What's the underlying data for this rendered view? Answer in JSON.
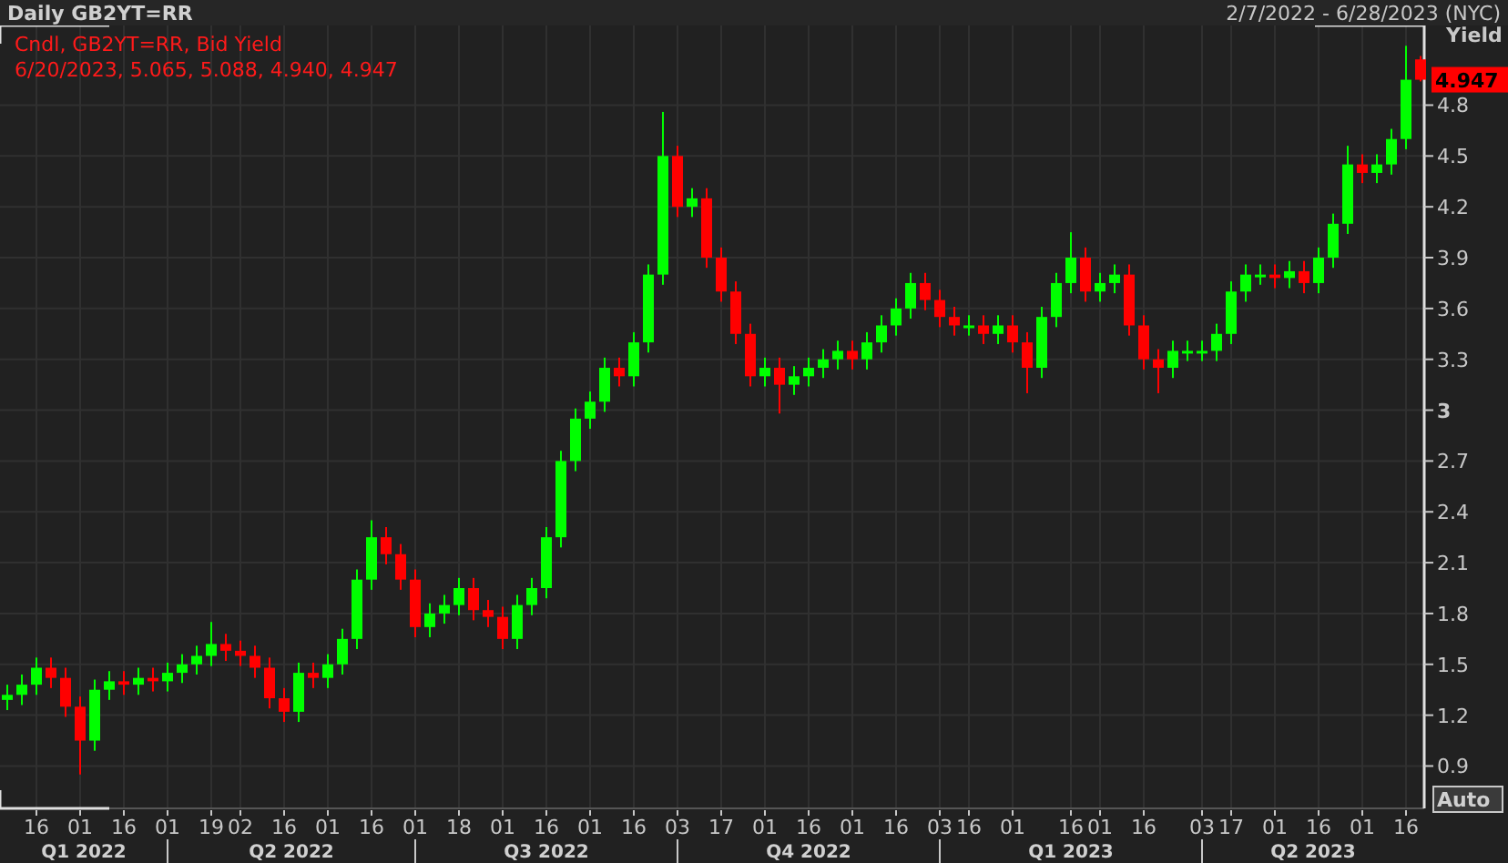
{
  "header": {
    "title": "Daily GB2YT=RR",
    "range": "2/7/2022 - 6/28/2023 (NYC)"
  },
  "legend": [
    "Cndl, GB2YT=RR, Bid Yield",
    "6/20/2023, 5.065, 5.088, 4.940, 4.947"
  ],
  "chart": {
    "last_value": "4.947",
    "auto_button": "Auto",
    "quarters": [
      "Q1 2022",
      "Q2 2022",
      "Q3 2022",
      "Q4 2022",
      "Q1 2023",
      "Q2 2023"
    ],
    "chart_data": {
      "type": "candlestick",
      "ylabel": "Yield",
      "grid": true,
      "ohlc": [
        [
          1.29,
          1.38,
          1.23,
          1.32
        ],
        [
          1.32,
          1.44,
          1.26,
          1.38
        ],
        [
          1.38,
          1.54,
          1.32,
          1.48
        ],
        [
          1.48,
          1.54,
          1.36,
          1.42
        ],
        [
          1.42,
          1.48,
          1.19,
          1.25
        ],
        [
          1.25,
          1.31,
          0.85,
          1.05
        ],
        [
          1.05,
          1.41,
          0.99,
          1.35
        ],
        [
          1.35,
          1.46,
          1.29,
          1.4
        ],
        [
          1.4,
          1.46,
          1.32,
          1.38
        ],
        [
          1.38,
          1.48,
          1.32,
          1.42
        ],
        [
          1.42,
          1.48,
          1.34,
          1.4
        ],
        [
          1.4,
          1.51,
          1.34,
          1.45
        ],
        [
          1.45,
          1.56,
          1.39,
          1.5
        ],
        [
          1.5,
          1.61,
          1.44,
          1.55
        ],
        [
          1.55,
          1.75,
          1.49,
          1.62
        ],
        [
          1.62,
          1.68,
          1.52,
          1.58
        ],
        [
          1.58,
          1.64,
          1.49,
          1.55
        ],
        [
          1.55,
          1.61,
          1.42,
          1.48
        ],
        [
          1.48,
          1.54,
          1.24,
          1.3
        ],
        [
          1.3,
          1.36,
          1.16,
          1.22
        ],
        [
          1.22,
          1.51,
          1.16,
          1.45
        ],
        [
          1.45,
          1.51,
          1.36,
          1.42
        ],
        [
          1.42,
          1.56,
          1.36,
          1.5
        ],
        [
          1.5,
          1.71,
          1.44,
          1.65
        ],
        [
          1.65,
          2.06,
          1.59,
          2.0
        ],
        [
          2.0,
          2.35,
          1.94,
          2.25
        ],
        [
          2.25,
          2.31,
          2.09,
          2.15
        ],
        [
          2.15,
          2.21,
          1.94,
          2.0
        ],
        [
          2.0,
          2.06,
          1.66,
          1.72
        ],
        [
          1.72,
          1.86,
          1.66,
          1.8
        ],
        [
          1.8,
          1.91,
          1.74,
          1.85
        ],
        [
          1.85,
          2.01,
          1.79,
          1.95
        ],
        [
          1.95,
          2.01,
          1.76,
          1.82
        ],
        [
          1.82,
          1.88,
          1.72,
          1.78
        ],
        [
          1.78,
          1.84,
          1.59,
          1.65
        ],
        [
          1.65,
          1.91,
          1.59,
          1.85
        ],
        [
          1.85,
          2.01,
          1.79,
          1.95
        ],
        [
          1.95,
          2.31,
          1.89,
          2.25
        ],
        [
          2.25,
          2.76,
          2.19,
          2.7
        ],
        [
          2.7,
          3.01,
          2.64,
          2.95
        ],
        [
          2.95,
          3.11,
          2.89,
          3.05
        ],
        [
          3.05,
          3.31,
          2.99,
          3.25
        ],
        [
          3.25,
          3.31,
          3.14,
          3.2
        ],
        [
          3.2,
          3.46,
          3.14,
          3.4
        ],
        [
          3.4,
          3.86,
          3.34,
          3.8
        ],
        [
          3.8,
          4.76,
          3.74,
          4.5
        ],
        [
          4.5,
          4.56,
          4.14,
          4.2
        ],
        [
          4.2,
          4.31,
          4.14,
          4.25
        ],
        [
          4.25,
          4.31,
          3.84,
          3.9
        ],
        [
          3.9,
          3.96,
          3.64,
          3.7
        ],
        [
          3.7,
          3.76,
          3.39,
          3.45
        ],
        [
          3.45,
          3.51,
          3.14,
          3.2
        ],
        [
          3.2,
          3.31,
          3.14,
          3.25
        ],
        [
          3.25,
          3.31,
          2.98,
          3.15
        ],
        [
          3.15,
          3.26,
          3.09,
          3.2
        ],
        [
          3.2,
          3.31,
          3.14,
          3.25
        ],
        [
          3.25,
          3.36,
          3.19,
          3.3
        ],
        [
          3.3,
          3.41,
          3.24,
          3.35
        ],
        [
          3.35,
          3.41,
          3.24,
          3.3
        ],
        [
          3.3,
          3.46,
          3.24,
          3.4
        ],
        [
          3.4,
          3.56,
          3.34,
          3.5
        ],
        [
          3.5,
          3.66,
          3.44,
          3.6
        ],
        [
          3.6,
          3.81,
          3.54,
          3.75
        ],
        [
          3.75,
          3.81,
          3.59,
          3.65
        ],
        [
          3.65,
          3.71,
          3.49,
          3.55
        ],
        [
          3.55,
          3.61,
          3.44,
          3.5
        ],
        [
          3.5,
          3.56,
          3.44,
          3.5
        ],
        [
          3.5,
          3.56,
          3.39,
          3.45
        ],
        [
          3.45,
          3.56,
          3.39,
          3.5
        ],
        [
          3.5,
          3.56,
          3.34,
          3.4
        ],
        [
          3.4,
          3.46,
          3.1,
          3.25
        ],
        [
          3.25,
          3.61,
          3.19,
          3.55
        ],
        [
          3.55,
          3.81,
          3.49,
          3.75
        ],
        [
          3.75,
          4.05,
          3.69,
          3.9
        ],
        [
          3.9,
          3.96,
          3.64,
          3.7
        ],
        [
          3.7,
          3.81,
          3.64,
          3.75
        ],
        [
          3.75,
          3.86,
          3.69,
          3.8
        ],
        [
          3.8,
          3.86,
          3.44,
          3.5
        ],
        [
          3.5,
          3.56,
          3.24,
          3.3
        ],
        [
          3.3,
          3.36,
          3.1,
          3.25
        ],
        [
          3.25,
          3.41,
          3.19,
          3.35
        ],
        [
          3.35,
          3.41,
          3.29,
          3.35
        ],
        [
          3.35,
          3.41,
          3.29,
          3.35
        ],
        [
          3.35,
          3.51,
          3.29,
          3.45
        ],
        [
          3.45,
          3.76,
          3.39,
          3.7
        ],
        [
          3.7,
          3.86,
          3.64,
          3.8
        ],
        [
          3.8,
          3.86,
          3.74,
          3.8
        ],
        [
          3.8,
          3.86,
          3.72,
          3.78
        ],
        [
          3.78,
          3.88,
          3.72,
          3.82
        ],
        [
          3.82,
          3.88,
          3.69,
          3.75
        ],
        [
          3.75,
          3.96,
          3.69,
          3.9
        ],
        [
          3.9,
          4.16,
          3.84,
          4.1
        ],
        [
          4.1,
          4.56,
          4.04,
          4.45
        ],
        [
          4.45,
          4.51,
          4.34,
          4.4
        ],
        [
          4.4,
          4.51,
          4.34,
          4.45
        ],
        [
          4.45,
          4.66,
          4.39,
          4.6
        ],
        [
          4.6,
          5.15,
          4.54,
          4.95
        ],
        [
          5.07,
          5.09,
          4.94,
          4.95
        ]
      ],
      "ylim": [
        0.65,
        5.27
      ],
      "yticks": [
        0.9,
        1.2,
        1.5,
        1.8,
        2.1,
        2.4,
        2.7,
        3,
        3.3,
        3.6,
        3.9,
        4.2,
        4.5,
        4.8
      ],
      "categories": [
        null,
        null,
        "16",
        null,
        null,
        "01",
        null,
        null,
        "16",
        null,
        null,
        "01",
        null,
        null,
        "19",
        null,
        "02",
        null,
        null,
        "16",
        null,
        null,
        "01",
        null,
        null,
        "16",
        null,
        null,
        "01",
        null,
        null,
        "18",
        null,
        null,
        "01",
        null,
        null,
        "16",
        null,
        null,
        "01",
        null,
        null,
        "16",
        null,
        null,
        "03",
        null,
        null,
        "17",
        null,
        null,
        "01",
        null,
        null,
        "16",
        null,
        null,
        "01",
        null,
        null,
        "16",
        null,
        null,
        "03",
        null,
        "16",
        null,
        null,
        "01",
        null,
        null,
        null,
        "16",
        null,
        "01",
        null,
        null,
        "16",
        null,
        null,
        null,
        "03",
        null,
        "17",
        null,
        null,
        "01",
        null,
        null,
        "16",
        null,
        null,
        "01",
        null,
        null,
        "16",
        null
      ]
    }
  }
}
